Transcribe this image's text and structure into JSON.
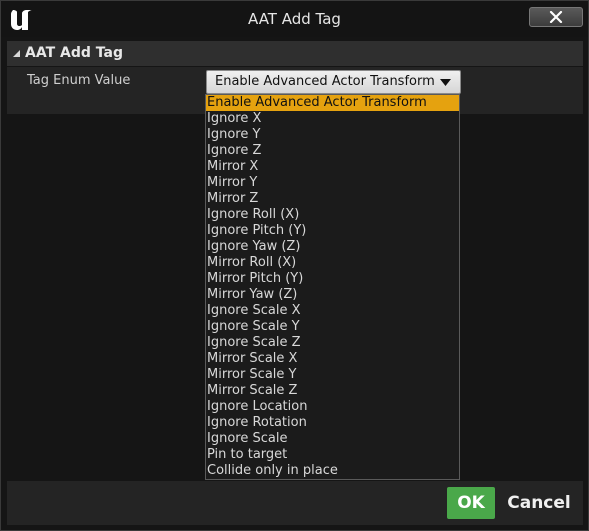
{
  "window": {
    "title": "AAT Add Tag",
    "logo": "unreal-engine-logo",
    "close_icon": "close-icon"
  },
  "section": {
    "title": "AAT Add Tag",
    "expand_icon": "collapse-triangle-icon"
  },
  "property": {
    "label": "Tag Enum Value",
    "value": "Enable Advanced Actor Transform",
    "arrow_icon": "chevron-down-icon"
  },
  "dropdown": {
    "selected_index": 0,
    "highlight_color": "#e5a20f",
    "options": [
      "Enable Advanced Actor Transform",
      "Ignore X",
      "Ignore Y",
      "Ignore Z",
      "Mirror X",
      "Mirror Y",
      "Mirror Z",
      "Ignore Roll (X)",
      "Ignore Pitch (Y)",
      "Ignore Yaw (Z)",
      "Mirror Roll (X)",
      "Mirror Pitch (Y)",
      "Mirror Yaw (Z)",
      "Ignore Scale X",
      "Ignore Scale Y",
      "Ignore Scale Z",
      "Mirror Scale X",
      "Mirror Scale Y",
      "Mirror Scale Z",
      "Ignore Location",
      "Ignore Rotation",
      "Ignore Scale",
      "Pin to target",
      "Collide only in place"
    ]
  },
  "footer": {
    "ok_label": "OK",
    "ok_color": "#4aa84a",
    "cancel_label": "Cancel"
  }
}
